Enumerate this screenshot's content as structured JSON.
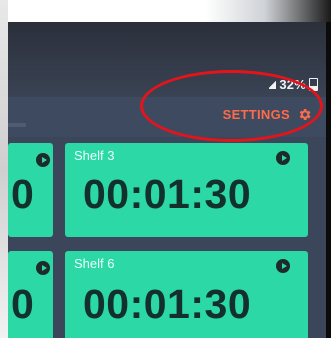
{
  "status_bar": {
    "battery_percent": "32%"
  },
  "app_bar": {
    "settings_label": "SETTINGS"
  },
  "tiles": [
    {
      "label": "",
      "time": "0"
    },
    {
      "label": "Shelf 3",
      "time": "00:01:30"
    },
    {
      "label": "",
      "time": "0"
    },
    {
      "label": "Shelf 6",
      "time": "00:01:30"
    }
  ],
  "icons": [
    "gear-icon",
    "play-icon",
    "signal-icon",
    "battery-icon"
  ],
  "colors": {
    "tile": "#2cd9a6",
    "settings_text": "#ff6a4a",
    "highlight": "#e6141a",
    "background": "#3b465a"
  }
}
